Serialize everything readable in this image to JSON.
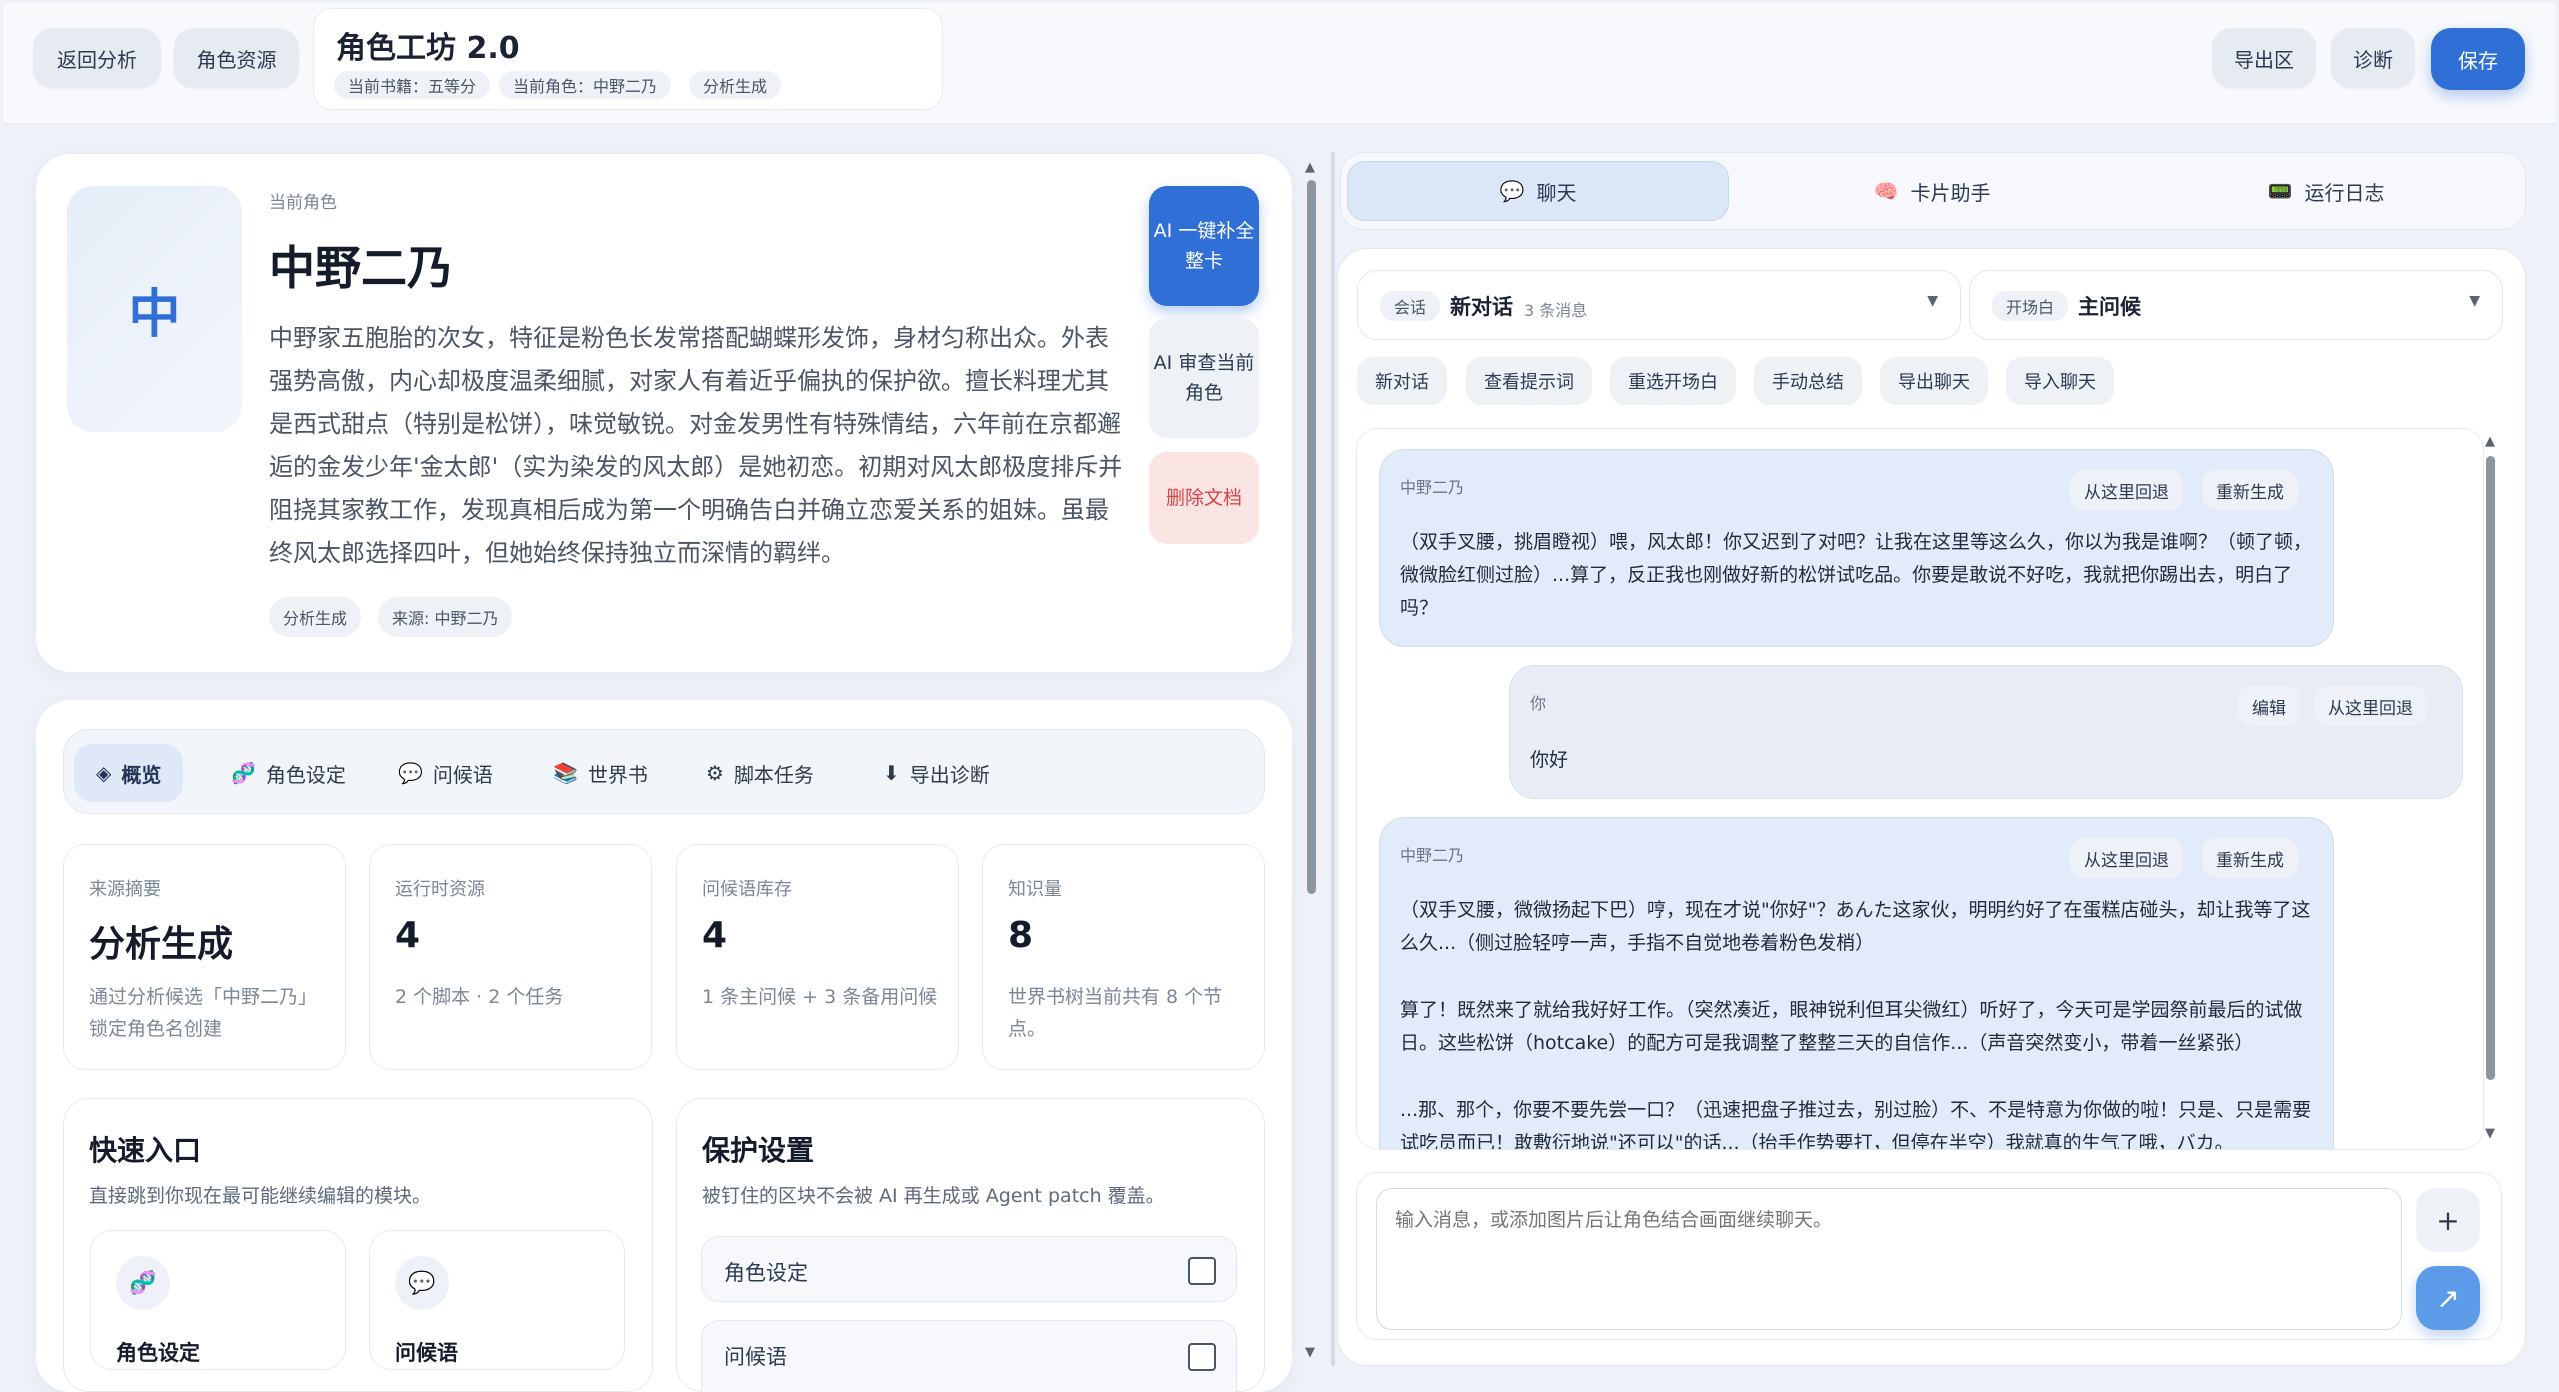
{
  "header": {
    "back_label": "返回分析",
    "resources_label": "角色资源",
    "app_title": "角色工坊 2.0",
    "chips": [
      "当前书籍：五等分",
      "当前角色：中野二乃",
      "分析生成"
    ],
    "export_label": "导出区",
    "diagnose_label": "诊断",
    "save_label": "保存"
  },
  "character": {
    "label": "当前角色",
    "name": "中野二乃",
    "avatar_char": "中",
    "description": "中野家五胞胎的次女，特征是粉色长发常搭配蝴蝶形发饰，身材匀称出众。外表强势高傲，内心却极度温柔细腻，对家人有着近乎偏执的保护欲。擅长料理尤其是西式甜点（特别是松饼），味觉敏锐。对金发男性有特殊情结，六年前在京都邂逅的金发少年'金太郎'（实为染发的风太郎）是她初恋。初期对风太郎极度排斥并阻挠其家教工作，发现真相后成为第一个明确告白并确立恋爱关系的姐妹。虽最终风太郎选择四叶，但她始终保持独立而深情的羁绊。",
    "tags": [
      "分析生成",
      "来源: 中野二乃"
    ],
    "ai_fill_label": "AI 一键补全整卡",
    "ai_review_label": "AI 审查当前角色",
    "delete_label": "删除文档"
  },
  "tabs": [
    {
      "icon": "◈",
      "label": "概览"
    },
    {
      "icon": "🧬",
      "label": "角色设定"
    },
    {
      "icon": "💬",
      "label": "问候语"
    },
    {
      "icon": "📚",
      "label": "世界书"
    },
    {
      "icon": "⚙",
      "label": "脚本任务"
    },
    {
      "icon": "⬇",
      "label": "导出诊断"
    }
  ],
  "stats": [
    {
      "label": "来源摘要",
      "value": "分析生成",
      "note": "通过分析候选「中野二乃」锁定角色名创建"
    },
    {
      "label": "运行时资源",
      "value": "4",
      "note": "2 个脚本 · 2 个任务"
    },
    {
      "label": "问候语库存",
      "value": "4",
      "note": "1 条主问候 + 3 条备用问候"
    },
    {
      "label": "知识量",
      "value": "8",
      "note": "世界书树当前共有 8 个节点。"
    }
  ],
  "quick": {
    "title": "快速入口",
    "subtitle": "直接跳到你现在最可能继续编辑的模块。",
    "items": [
      {
        "icon": "🧬",
        "label": "角色设定"
      },
      {
        "icon": "💬",
        "label": "问候语"
      }
    ]
  },
  "protect": {
    "title": "保护设置",
    "subtitle": "被钉住的区块不会被 AI 再生成或 Agent patch 覆盖。",
    "rows": [
      "角色设定",
      "问候语"
    ]
  },
  "right_tabs": [
    {
      "icon": "💬",
      "label": "聊天"
    },
    {
      "icon": "🧠",
      "label": "卡片助手"
    },
    {
      "icon": "📟",
      "label": "运行日志"
    }
  ],
  "session": {
    "tag": "会话",
    "name": "新对话",
    "count": "3 条消息",
    "opening_tag": "开场白",
    "opening": "主问候"
  },
  "chat_actions": [
    "新对话",
    "查看提示词",
    "重选开场白",
    "手动总结",
    "导出聊天",
    "导入聊天"
  ],
  "messages": [
    {
      "who": "中野二乃",
      "btn1": "从这里回退",
      "btn2": "重新生成",
      "text": "（双手叉腰，挑眉瞪视）喂，风太郎！你又迟到了对吧？让我在这里等这么久，你以为我是谁啊？（顿了顿，微微脸红侧过脸）...算了，反正我也刚做好新的松饼试吃品。你要是敢说不好吃，我就把你踢出去，明白了吗？"
    },
    {
      "who": "你",
      "btn1": "编辑",
      "btn2": "从这里回退",
      "text": "你好"
    },
    {
      "who": "中野二乃",
      "btn1": "从这里回退",
      "btn2": "重新生成",
      "p1": "（双手叉腰，微微扬起下巴）哼，现在才说\"你好\"？あんた这家伙，明明约好了在蛋糕店碰头，却让我等了这么久...（侧过脸轻哼一声，手指不自觉地卷着粉色发梢）",
      "p2": "算了！既然来了就给我好好工作。（突然凑近，眼神锐利但耳尖微红）听好了，今天可是学园祭前最后的试做日。这些松饼（hotcake）的配方可是我调整了整整三天的自信作...（声音突然变小，带着一丝紧张）",
      "p3": "...那、那个，你要不要先尝一口？（迅速把盘子推过去，别过脸）不、不是特意为你做的啦！只是、只是需要试吃员而已！敢敷衍地说\"还可以\"的话...（抬手作势要打，但停在半空）我就真的生气了哦，バカ。"
    }
  ],
  "input": {
    "placeholder": "输入消息，或添加图片后让角色结合画面继续聊天。"
  }
}
